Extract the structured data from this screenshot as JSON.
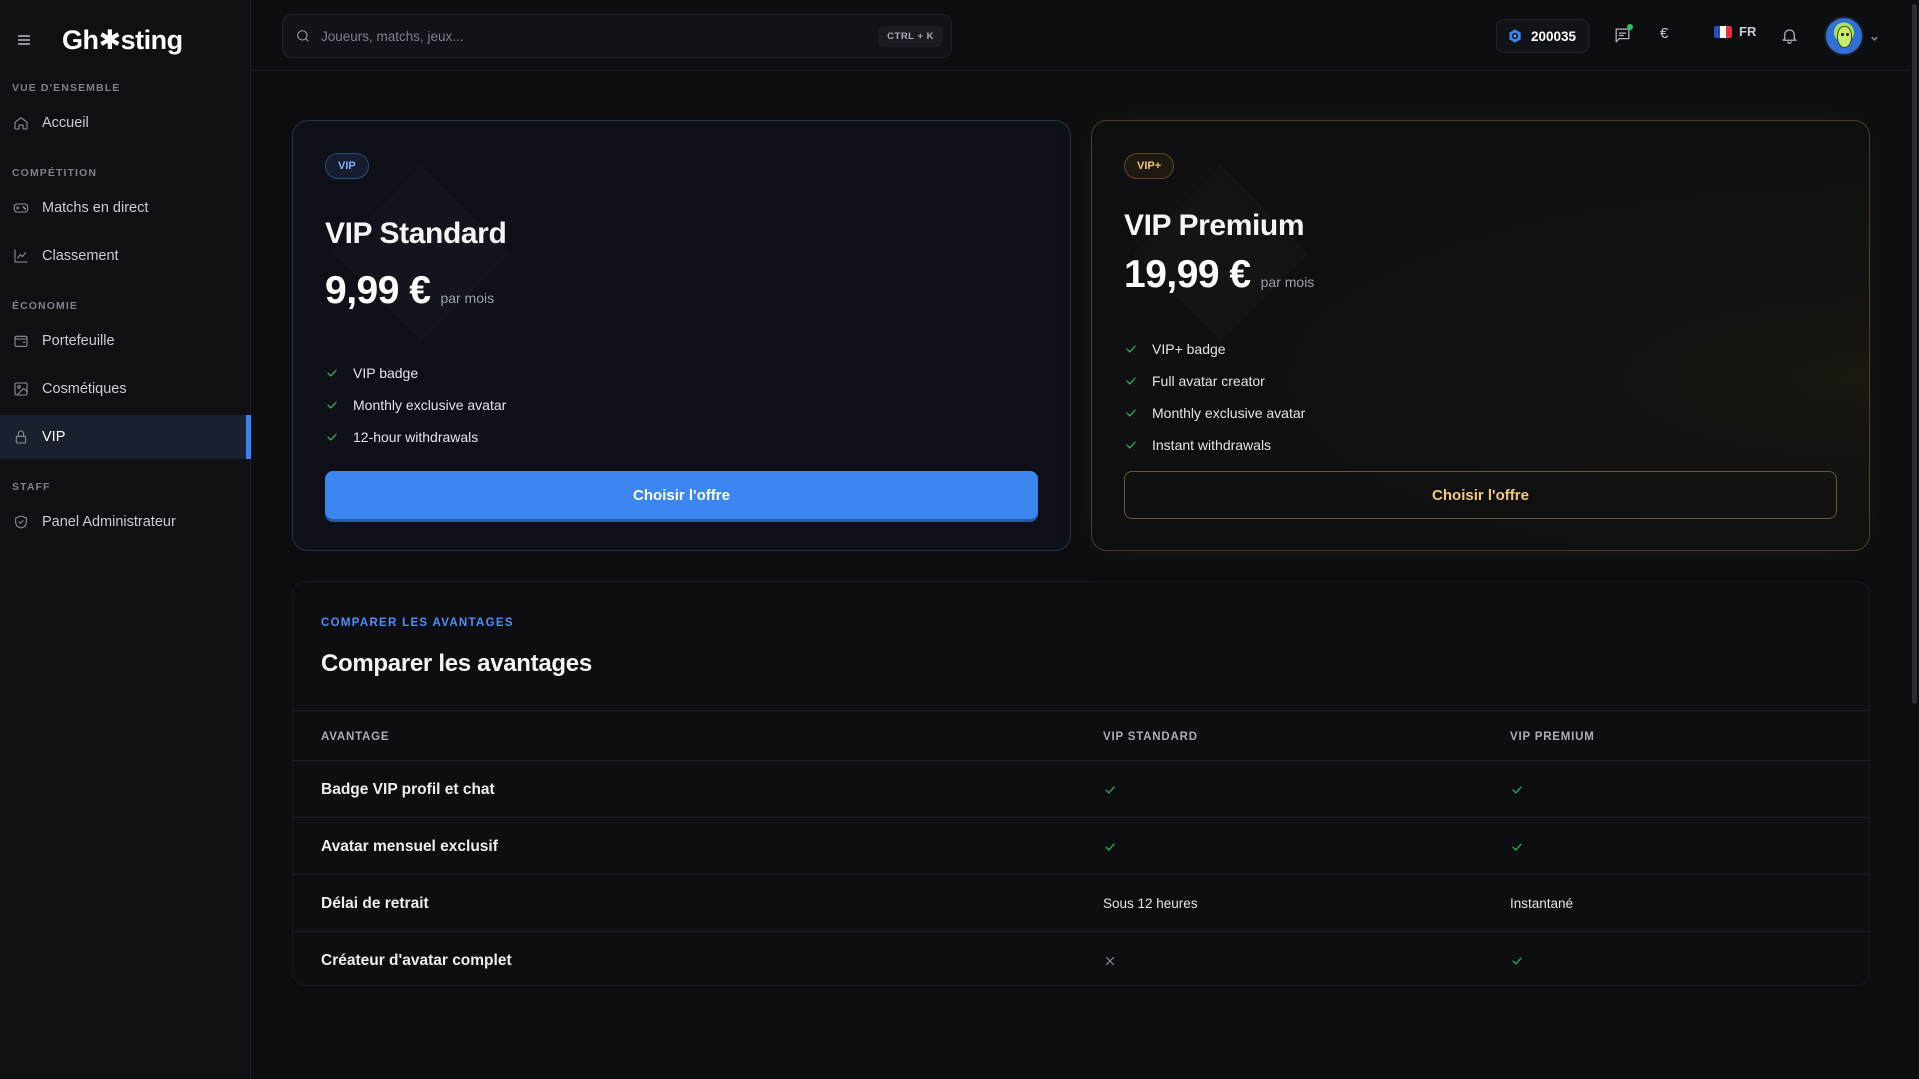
{
  "app": {
    "logo": "Gh✱sting"
  },
  "sidebar": {
    "sections": [
      {
        "title": "VUE D'ENSEMBLE",
        "items": [
          {
            "label": "Accueil",
            "icon": "home-icon"
          }
        ]
      },
      {
        "title": "COMPÉTITION",
        "items": [
          {
            "label": "Matchs en direct",
            "icon": "gamepad-icon"
          },
          {
            "label": "Classement",
            "icon": "chart-icon"
          }
        ]
      },
      {
        "title": "ÉCONOMIE",
        "items": [
          {
            "label": "Portefeuille",
            "icon": "wallet-icon"
          },
          {
            "label": "Cosmétiques",
            "icon": "image-icon"
          },
          {
            "label": "VIP",
            "icon": "lock-icon",
            "active": true
          }
        ]
      },
      {
        "title": "STAFF",
        "items": [
          {
            "label": "Panel Administrateur",
            "icon": "shield-icon"
          }
        ]
      }
    ]
  },
  "topbar": {
    "search_placeholder": "Joueurs, matchs, jeux...",
    "shortcut": "CTRL + K",
    "coins": "200035",
    "currency": "€",
    "language": "FR"
  },
  "plans": {
    "standard": {
      "badge": "VIP",
      "name": "VIP Standard",
      "price": "9,99 €",
      "period": "par mois",
      "features": [
        "VIP badge",
        "Monthly exclusive avatar",
        "12-hour withdrawals"
      ],
      "cta": "Choisir l'offre"
    },
    "premium": {
      "badge": "VIP+",
      "name": "VIP Premium",
      "price": "19,99 €",
      "period": "par mois",
      "features": [
        "VIP+ badge",
        "Full avatar creator",
        "Monthly exclusive avatar",
        "Instant withdrawals"
      ],
      "cta": "Choisir l'offre"
    }
  },
  "compare": {
    "eyebrow": "COMPARER LES AVANTAGES",
    "title": "Comparer les avantages",
    "headers": [
      "AVANTAGE",
      "VIP STANDARD",
      "VIP PREMIUM"
    ],
    "rows": [
      {
        "label": "Badge VIP profil et chat",
        "standard": "check",
        "premium": "check"
      },
      {
        "label": "Avatar mensuel exclusif",
        "standard": "check",
        "premium": "check"
      },
      {
        "label": "Délai de retrait",
        "standard": "Sous 12 heures",
        "premium": "Instantané"
      },
      {
        "label": "Créateur d'avatar complet",
        "standard": "cross",
        "premium": "check"
      }
    ]
  },
  "colors": {
    "accent": "#3b86f0",
    "success": "#22c55e",
    "gold": "#f3c879",
    "background": "#0c0d10"
  }
}
